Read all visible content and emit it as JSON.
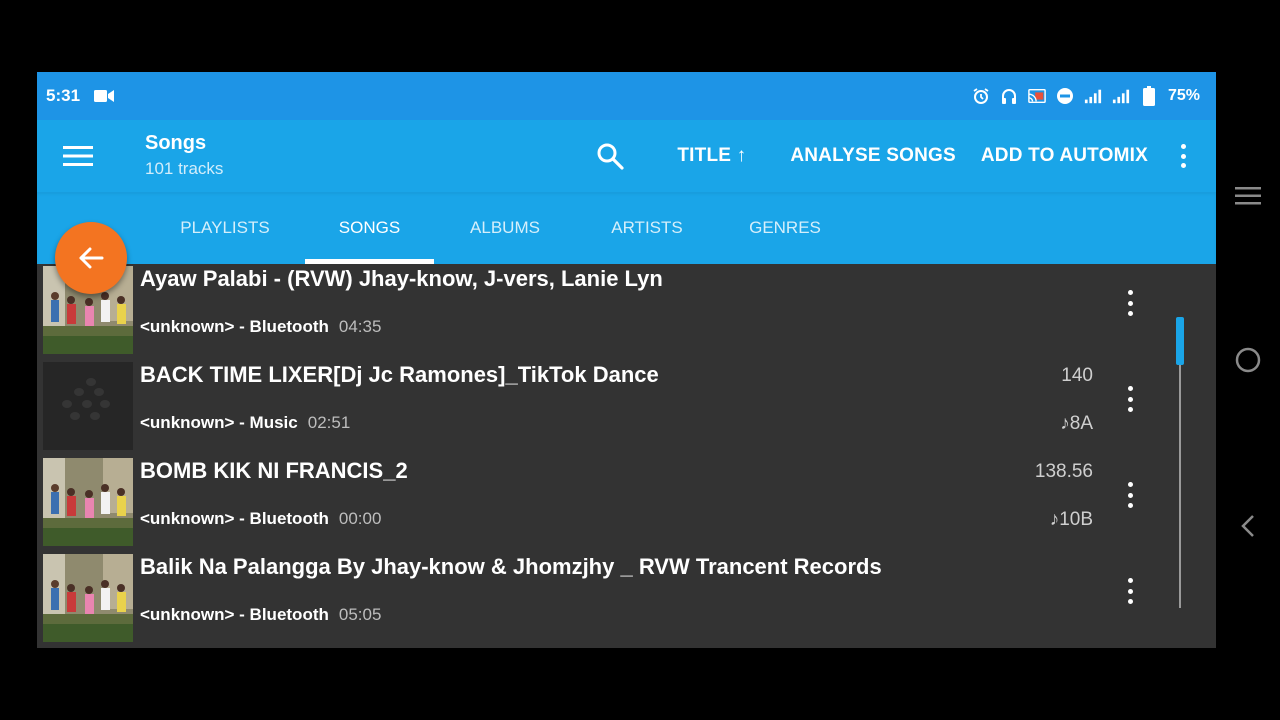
{
  "status_bar": {
    "time": "5:31",
    "battery_percent": "75%",
    "icons": [
      "video-camera-icon",
      "alarm-icon",
      "headphones-icon",
      "cast-icon",
      "do-not-disturb-icon",
      "signal-icon",
      "signal-icon",
      "battery-icon"
    ]
  },
  "app_bar": {
    "title": "Songs",
    "subtitle": "101 tracks",
    "sort_label": "TITLE ↑",
    "analyse_label": "ANALYSE SONGS",
    "automix_label": "ADD TO AUTOMIX"
  },
  "tabs": [
    {
      "label": "PLAYLISTS",
      "active": false
    },
    {
      "label": "SONGS",
      "active": true
    },
    {
      "label": "ALBUMS",
      "active": false
    },
    {
      "label": "ARTISTS",
      "active": false
    },
    {
      "label": "GENRES",
      "active": false
    }
  ],
  "tracks": [
    {
      "title": "Ayaw Palabi - (RVW) Jhay-know, J-vers, Lanie Lyn",
      "source": "<unknown> - Bluetooth",
      "duration": "04:35",
      "bpm": "",
      "key": "",
      "thumb": "photo"
    },
    {
      "title": "BACK TIME LIXER[Dj Jc Ramones]_TikTok Dance",
      "source": "<unknown> - Music",
      "duration": "02:51",
      "bpm": "140",
      "key": "♪8A",
      "thumb": "dark"
    },
    {
      "title": "BOMB KIK NI FRANCIS_2",
      "source": "<unknown> - Bluetooth",
      "duration": "00:00",
      "bpm": "138.56",
      "key": "♪10B",
      "thumb": "photo"
    },
    {
      "title": "Balik Na Palangga By Jhay-know & Jhomzjhy _ RVW Trancent Records",
      "source": "<unknown> - Bluetooth",
      "duration": "05:05",
      "bpm": "",
      "key": "",
      "thumb": "photo"
    }
  ],
  "colors": {
    "status_bar": "#1e94e6",
    "app_bar": "#1aa5e8",
    "fab": "#f37421",
    "list_bg": "#333333"
  },
  "scroll_position": 0.0
}
